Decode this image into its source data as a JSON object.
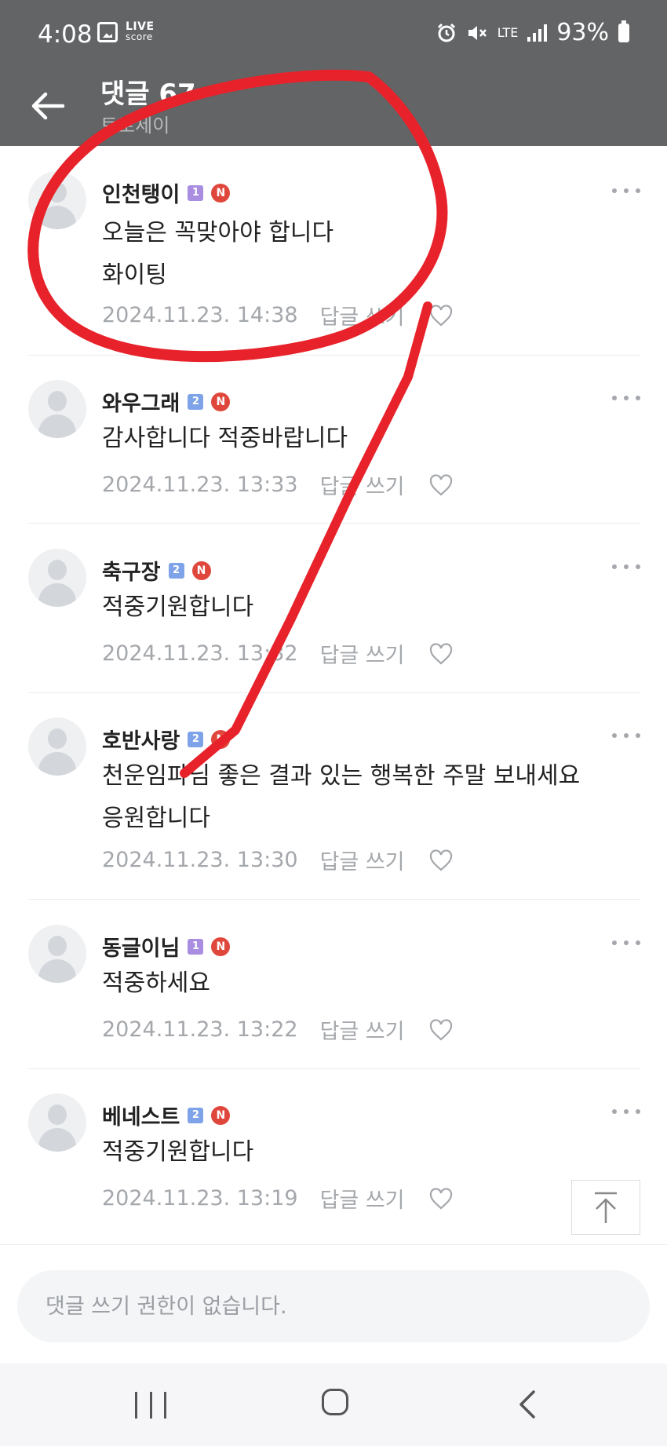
{
  "status_bar": {
    "time": "4:08",
    "live_logo_top": "LIVE",
    "live_logo_bottom": "score",
    "lte_label": "LTE",
    "battery": "93%"
  },
  "header": {
    "title": "댓글 67",
    "subtitle": "토로세이"
  },
  "comments": [
    {
      "nickname": "인천탱이",
      "level": "1",
      "badge": "N",
      "lines": [
        "오늘은 꼭맞아야 합니다",
        "화이팅"
      ],
      "date": "2024.11.23. 14:38",
      "reply_label": "답글 쓰기"
    },
    {
      "nickname": "와우그래",
      "level": "2",
      "badge": "N",
      "lines": [
        "감사합니다 적중바랍니다"
      ],
      "date": "2024.11.23. 13:33",
      "reply_label": "답글 쓰기"
    },
    {
      "nickname": "축구장",
      "level": "2",
      "badge": "N",
      "lines": [
        "적중기원합니다"
      ],
      "date": "2024.11.23. 13:32",
      "reply_label": "답글 쓰기"
    },
    {
      "nickname": "호반사랑",
      "level": "2",
      "badge": "N",
      "lines": [
        "천운임파님 좋은 결과 있는 행복한 주말 보내세요",
        "응원합니다"
      ],
      "date": "2024.11.23. 13:30",
      "reply_label": "답글 쓰기"
    },
    {
      "nickname": "동글이님",
      "level": "1",
      "badge": "N",
      "lines": [
        "적중하세요"
      ],
      "date": "2024.11.23. 13:22",
      "reply_label": "답글 쓰기"
    },
    {
      "nickname": "베네스트",
      "level": "2",
      "badge": "N",
      "lines": [
        "적중기원합니다"
      ],
      "date": "2024.11.23. 13:19",
      "reply_label": "답글 쓰기"
    }
  ],
  "input": {
    "placeholder": "댓글 쓰기 권한이 없습니다."
  },
  "colors": {
    "header_bg": "#636466",
    "annotation_red": "#e8222a",
    "new_badge": "#e0473c",
    "level1": "#a88de0",
    "level2": "#7ea3e8"
  },
  "icons": [
    "back-arrow-icon",
    "alarm-icon",
    "mute-icon",
    "signal-icon",
    "battery-icon",
    "more-icon",
    "heart-icon",
    "scroll-top-icon"
  ]
}
